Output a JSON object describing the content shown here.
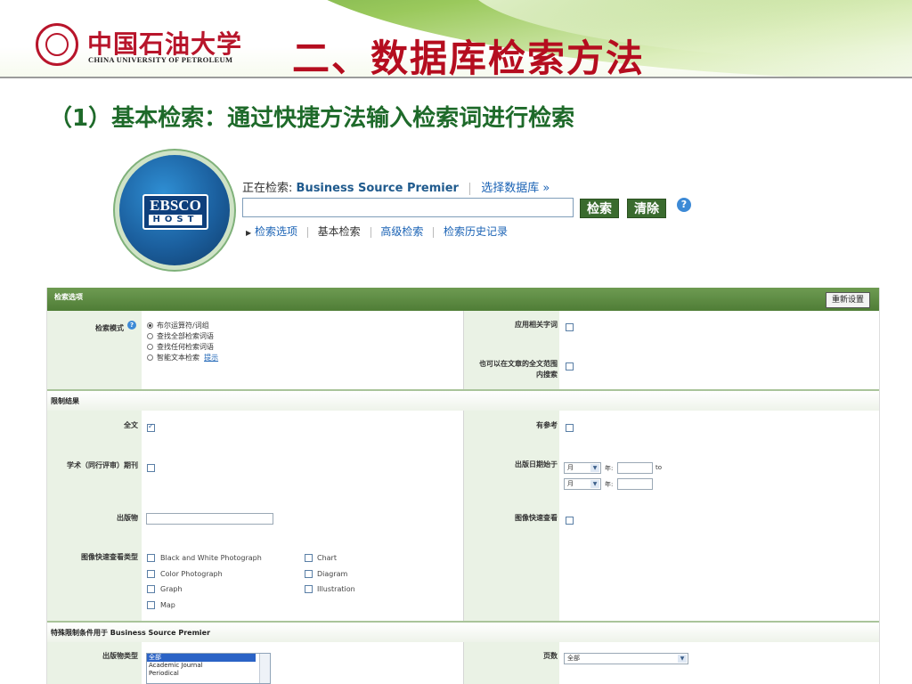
{
  "header": {
    "univ_name_cn": "中国石油大学",
    "univ_name_en": "CHINA UNIVERSITY OF PETROLEUM",
    "slide_title": "二、数据库检索方法",
    "subtitle": "（1）基本检索：通过快捷方法输入检索词进行检索",
    "accent_color": "#b50d1f",
    "green_color": "#1e6a2a"
  },
  "ebsco": {
    "logo_top": "EBSCO",
    "logo_bottom": "HOST",
    "searching_label": "正在检索:",
    "database": "Business Source Premier",
    "choose_db": "选择数据库 »",
    "search_value": "",
    "search_button": "检索",
    "clear_button": "清除",
    "help": "?",
    "links": [
      "检索选项",
      "基本检索",
      "高级检索",
      "检索历史记录"
    ]
  },
  "panel": {
    "title": "检索选项",
    "reset_button": "重新设置",
    "search_modes": {
      "label": "检索模式",
      "options": [
        "布尔运算符/词组",
        "查找全部检索词语",
        "查找任何检索词语",
        "智能文本检索"
      ],
      "selected_index": 0,
      "hint": "提示"
    },
    "apply_related": "应用相关字词",
    "fulltext_search": [
      "也可以在文章的全文范围",
      "内搜索"
    ],
    "limit_section": "限制结果",
    "fulltext": {
      "label": "全文",
      "checked": true
    },
    "references": {
      "label": "有参考",
      "checked": false
    },
    "scholarly": {
      "label": "学术（同行评审）期刊",
      "checked": false
    },
    "pub_date": {
      "label": "出版日期始于",
      "month_placeholder": "月",
      "year_label": "年:",
      "to": "to"
    },
    "publication": {
      "label": "出版物",
      "value": ""
    },
    "image_quick_view": {
      "label": "图像快速查看",
      "checked": false
    },
    "image_types": {
      "label": "图像快速查看类型",
      "left": [
        "Black and White Photograph",
        "Color Photograph",
        "Graph",
        "Map"
      ],
      "right": [
        "Chart",
        "Diagram",
        "Illustration"
      ]
    },
    "special_section": "特殊限制条件用于 Business Source Premier",
    "pub_type": {
      "label": "出版物类型",
      "options": [
        "全部",
        "Academic Journal",
        "Periodical"
      ]
    },
    "pages": {
      "label": "页数",
      "value": "全部"
    }
  }
}
